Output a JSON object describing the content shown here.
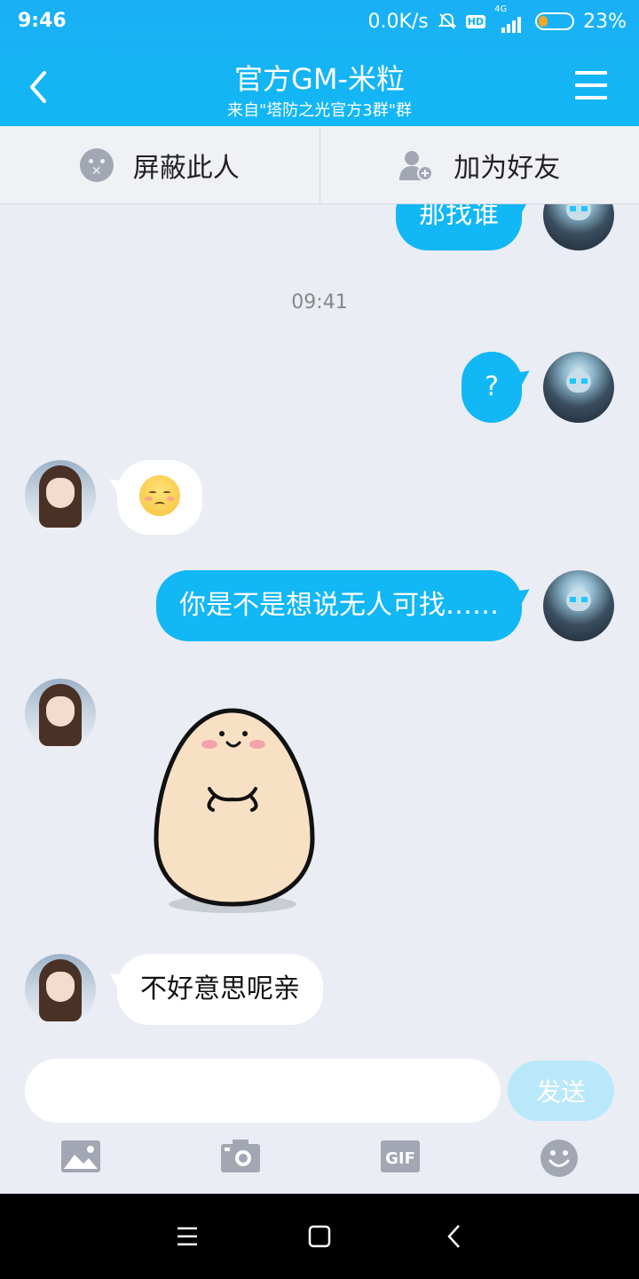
{
  "status": {
    "time": "9:46",
    "speed": "0.0K/s",
    "hd": "HD",
    "network": "4G",
    "battery": "23%"
  },
  "header": {
    "title": "官方GM-米粒",
    "subtitle": "来自\"塔防之光官方3群\"群",
    "back_icon": "chevron-left-icon",
    "menu_icon": "menu-icon"
  },
  "actions": {
    "block_label": "屏蔽此人",
    "add_friend_label": "加为好友"
  },
  "messages": {
    "m0_text": "那找谁",
    "time_sep": "09:41",
    "m1_text": "?",
    "m2_emoji": "pensive-face-emoji",
    "m3_text": "你是不是想说无人可找……",
    "m4_sticker": "egg-sticker",
    "m5_text": "不好意思呢亲"
  },
  "composer": {
    "input_value": "",
    "send_label": "发送",
    "tools": [
      "image-icon",
      "camera-icon",
      "gif-icon",
      "emoji-icon"
    ],
    "gif_label": "GIF"
  },
  "colors": {
    "accent": "#12b7f5",
    "background": "#eaedf4",
    "send_disabled": "#b9e8fb"
  }
}
